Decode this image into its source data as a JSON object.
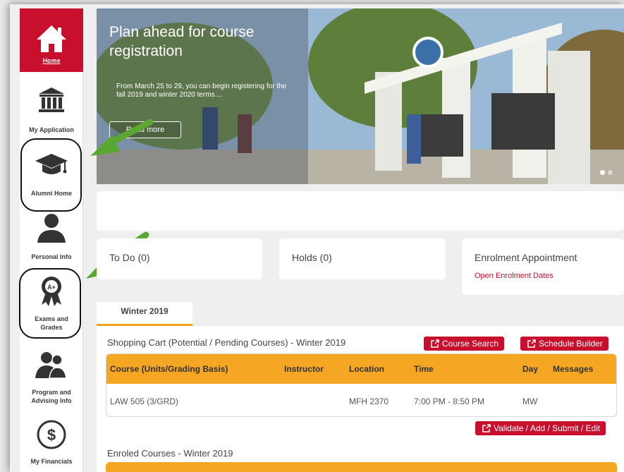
{
  "sidebar": {
    "items": [
      {
        "label": "Home"
      },
      {
        "label": "My Application"
      },
      {
        "label": "Alumni Home"
      },
      {
        "label": "Personal Info"
      },
      {
        "label": "Exams and Grades"
      },
      {
        "label": "Program and Advising Info"
      },
      {
        "label": "My Financials"
      }
    ]
  },
  "banner": {
    "title": "Plan ahead for course registration",
    "body": "From March 25 to 29, you can begin registering for the fall 2019 and winter 2020 terms....",
    "button": "Read more"
  },
  "cards": {
    "todo": "To Do (0)",
    "holds": "Holds (0)",
    "enrolment_title": "Enrolment Appointment",
    "enrolment_link": "Open Enrolment Dates"
  },
  "term_tab": "Winter 2019",
  "shopping_cart": {
    "title": "Shopping Cart (Potential / Pending Courses) - Winter 2019",
    "buttons": {
      "course_search": "Course Search",
      "schedule_builder": "Schedule Builder"
    },
    "columns": [
      "Course (Units/Grading Basis)",
      "Instructor",
      "Location",
      "Time",
      "Day",
      "Messages"
    ],
    "rows": [
      {
        "course": "LAW 505 (3/GRD)",
        "instructor": "",
        "location": "MFH 2370",
        "time": "7:00 PM - 8:50 PM",
        "day": "MW",
        "messages": ""
      }
    ],
    "action_button": "Validate / Add / Submit / Edit"
  },
  "enrolled": {
    "title": "Enroled Courses - Winter 2019"
  },
  "colors": {
    "brand_red": "#c8102e",
    "accent_orange": "#f5a623",
    "arrow_green": "#5aa832"
  }
}
